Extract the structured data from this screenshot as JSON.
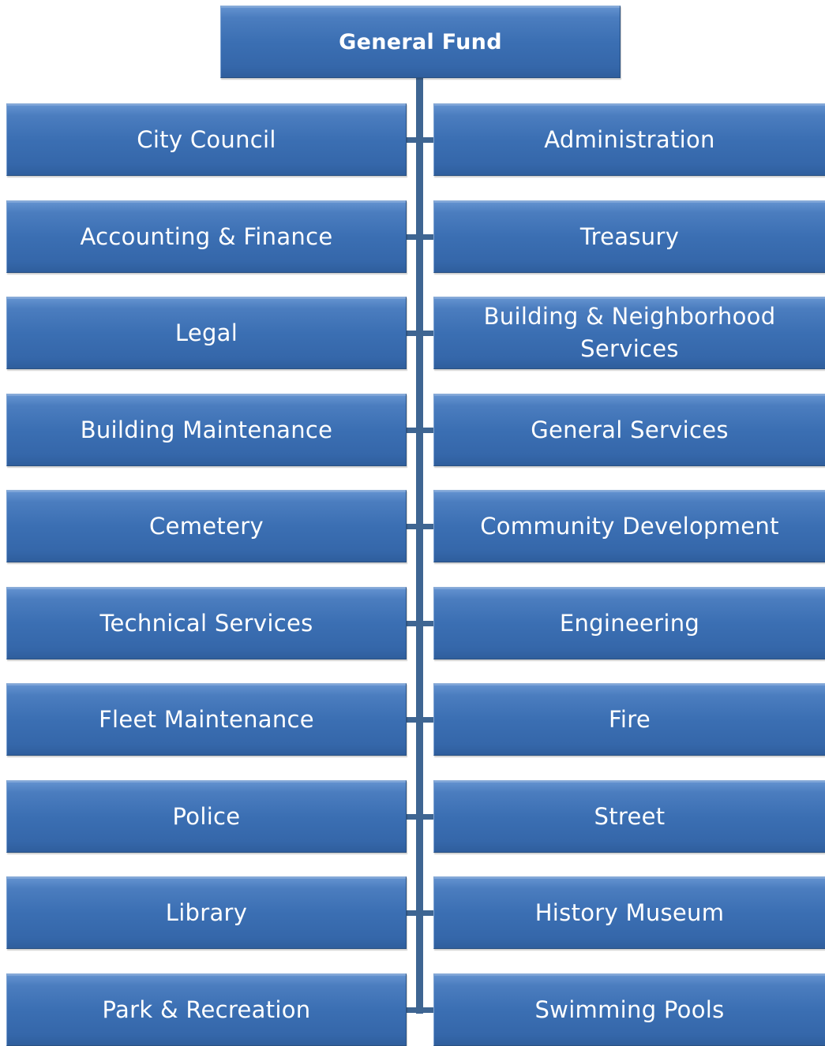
{
  "diagram": {
    "root": {
      "label": "General Fund"
    },
    "left_column": [
      "City Council",
      "Accounting & Finance",
      "Legal",
      "Building Maintenance",
      "Cemetery",
      "Technical Services",
      "Fleet Maintenance",
      "Police",
      "Library",
      "Park & Recreation"
    ],
    "right_column": [
      "Administration",
      "Treasury",
      "Building & Neighborhood Services",
      "General Services",
      "Community Development",
      "Engineering",
      "Fire",
      "Street",
      "History Museum",
      "Swimming Pools"
    ],
    "colors": {
      "box_fill": "#3b6fb3",
      "box_text": "#ffffff",
      "connector": "#3e6592"
    }
  }
}
